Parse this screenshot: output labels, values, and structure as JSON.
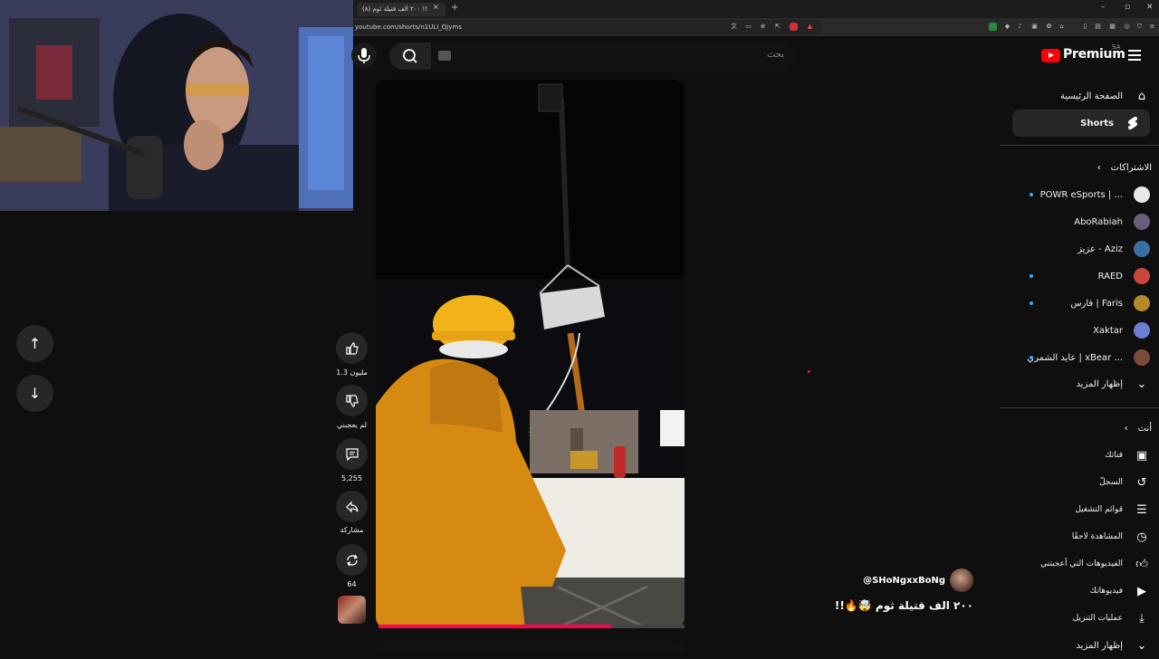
{
  "browser": {
    "tab_title": "٢٠٠ الف قتيلة ثوم (٨) !!",
    "tab_close": "×",
    "new_tab": "+",
    "url": "youtube.com/shorts/n1ULI_Qjyms",
    "window_controls": [
      "–",
      "▫",
      "✕"
    ]
  },
  "masthead": {
    "logo_text": "Premium",
    "country_code": "SA",
    "search_placeholder": "بحث"
  },
  "sidebar": {
    "main": [
      {
        "label": "الصفحة الرئيسية",
        "icon": "home-icon"
      },
      {
        "label": "Shorts",
        "icon": "shorts-icon"
      }
    ],
    "subscriptions_header": "الاشتراكات",
    "subscriptions": [
      {
        "label": "POWR eSports | ...",
        "color": "#e9e9e9",
        "dot": true
      },
      {
        "label": "AboRabiah",
        "color": "#6a5d7a",
        "dot": false
      },
      {
        "label": "عزيز - Aziz",
        "color": "#3a6ea5",
        "dot": false
      },
      {
        "label": "RAED",
        "color": "#c9463d",
        "dot": true
      },
      {
        "label": "فارس | Faris",
        "color": "#b58a2a",
        "dot": true
      },
      {
        "label": "Xaktar",
        "color": "#6a7fd0",
        "dot": false
      },
      {
        "label": "عايد الشمري | xBear ...",
        "color": "#7a4a3a",
        "dot": true
      }
    ],
    "show_more_1": "إظهار المزيد",
    "you_header": "أنت",
    "you_items": [
      {
        "label": "قناتك",
        "icon": "your-channel-icon"
      },
      {
        "label": "السجلّ",
        "icon": "history-icon"
      },
      {
        "label": "قوائم التشغيل",
        "icon": "playlists-icon"
      },
      {
        "label": "المشاهدة لاحقًا",
        "icon": "watch-later-icon"
      },
      {
        "label": "الفيديوهات التي أعجبتني",
        "icon": "liked-videos-icon"
      },
      {
        "label": "فيديوهاتك",
        "icon": "your-videos-icon"
      },
      {
        "label": "عمليات التنزيل",
        "icon": "downloads-icon"
      }
    ],
    "show_more_2": "إظهار المزيد"
  },
  "actions": {
    "like_count": "1.3 مليون",
    "dislike_label": "لم يعجبني",
    "comment_count": "5,255",
    "share_label": "مشاركة",
    "remix_count": "64"
  },
  "short": {
    "channel": "@SHoNgxxBoNg",
    "title": "٢٠٠ الف قتيلة ثوم 🤯🔥!!",
    "progress": 0.76
  }
}
